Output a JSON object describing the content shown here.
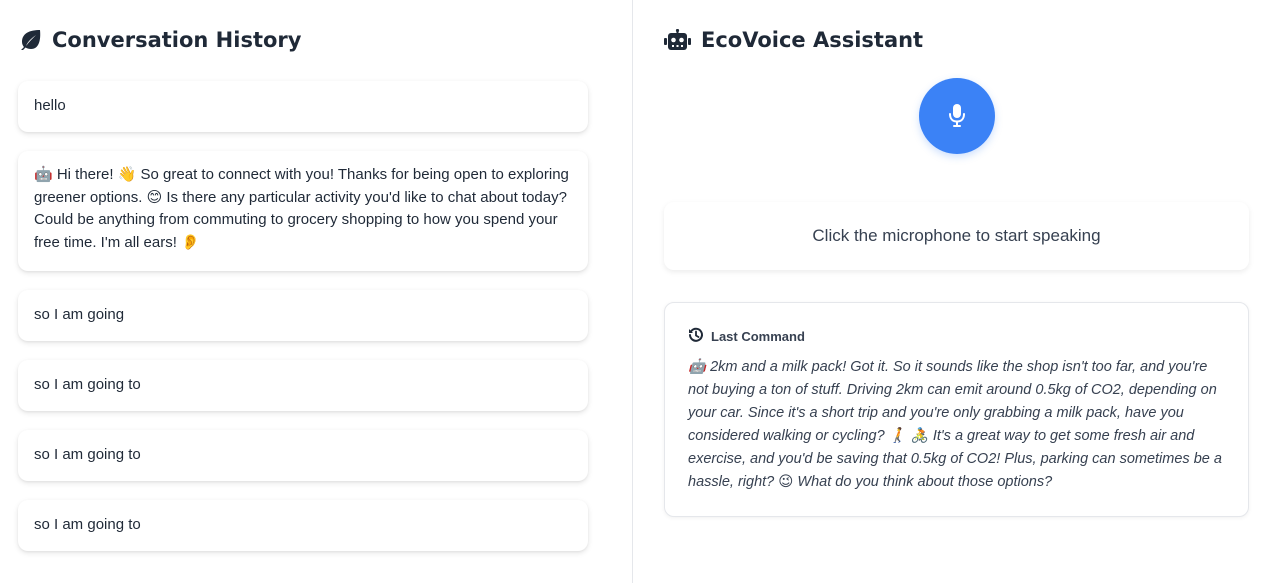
{
  "history": {
    "title": "Conversation History",
    "icon": "leaf-icon",
    "messages": [
      {
        "text": "hello",
        "type": "user"
      },
      {
        "text": "🤖 Hi there! 👋 So great to connect with you! Thanks for being open to exploring greener options. 😊 Is there any particular activity you'd like to chat about today? Could be anything from commuting to grocery shopping to how you spend your free time. I'm all ears! 👂",
        "type": "assistant"
      },
      {
        "text": "so I am going",
        "type": "user"
      },
      {
        "text": "so I am going to",
        "type": "user"
      },
      {
        "text": "so I am going to",
        "type": "user"
      },
      {
        "text": "so I am going to",
        "type": "user"
      }
    ]
  },
  "assistant": {
    "title": "EcoVoice Assistant",
    "icon": "robot-icon",
    "mic_icon": "microphone-icon",
    "status_text": "Click the microphone to start speaking",
    "last_command": {
      "icon": "history-icon",
      "title": "Last Command",
      "text": "🤖 2km and a milk pack! Got it. So it sounds like the shop isn't too far, and you're not buying a ton of stuff. Driving 2km can emit around 0.5kg of CO2, depending on your car. Since it's a short trip and you're only grabbing a milk pack, have you considered walking or cycling? 🚶 🚴 It's a great way to get some fresh air and exercise, and you'd be saving that 0.5kg of CO2! Plus, parking can sometimes be a hassle, right? 😉 What do you think about those options?"
    }
  },
  "colors": {
    "accent": "#3b82f6",
    "text": "#1f2937",
    "muted": "#374151",
    "border": "#e5e7eb"
  }
}
